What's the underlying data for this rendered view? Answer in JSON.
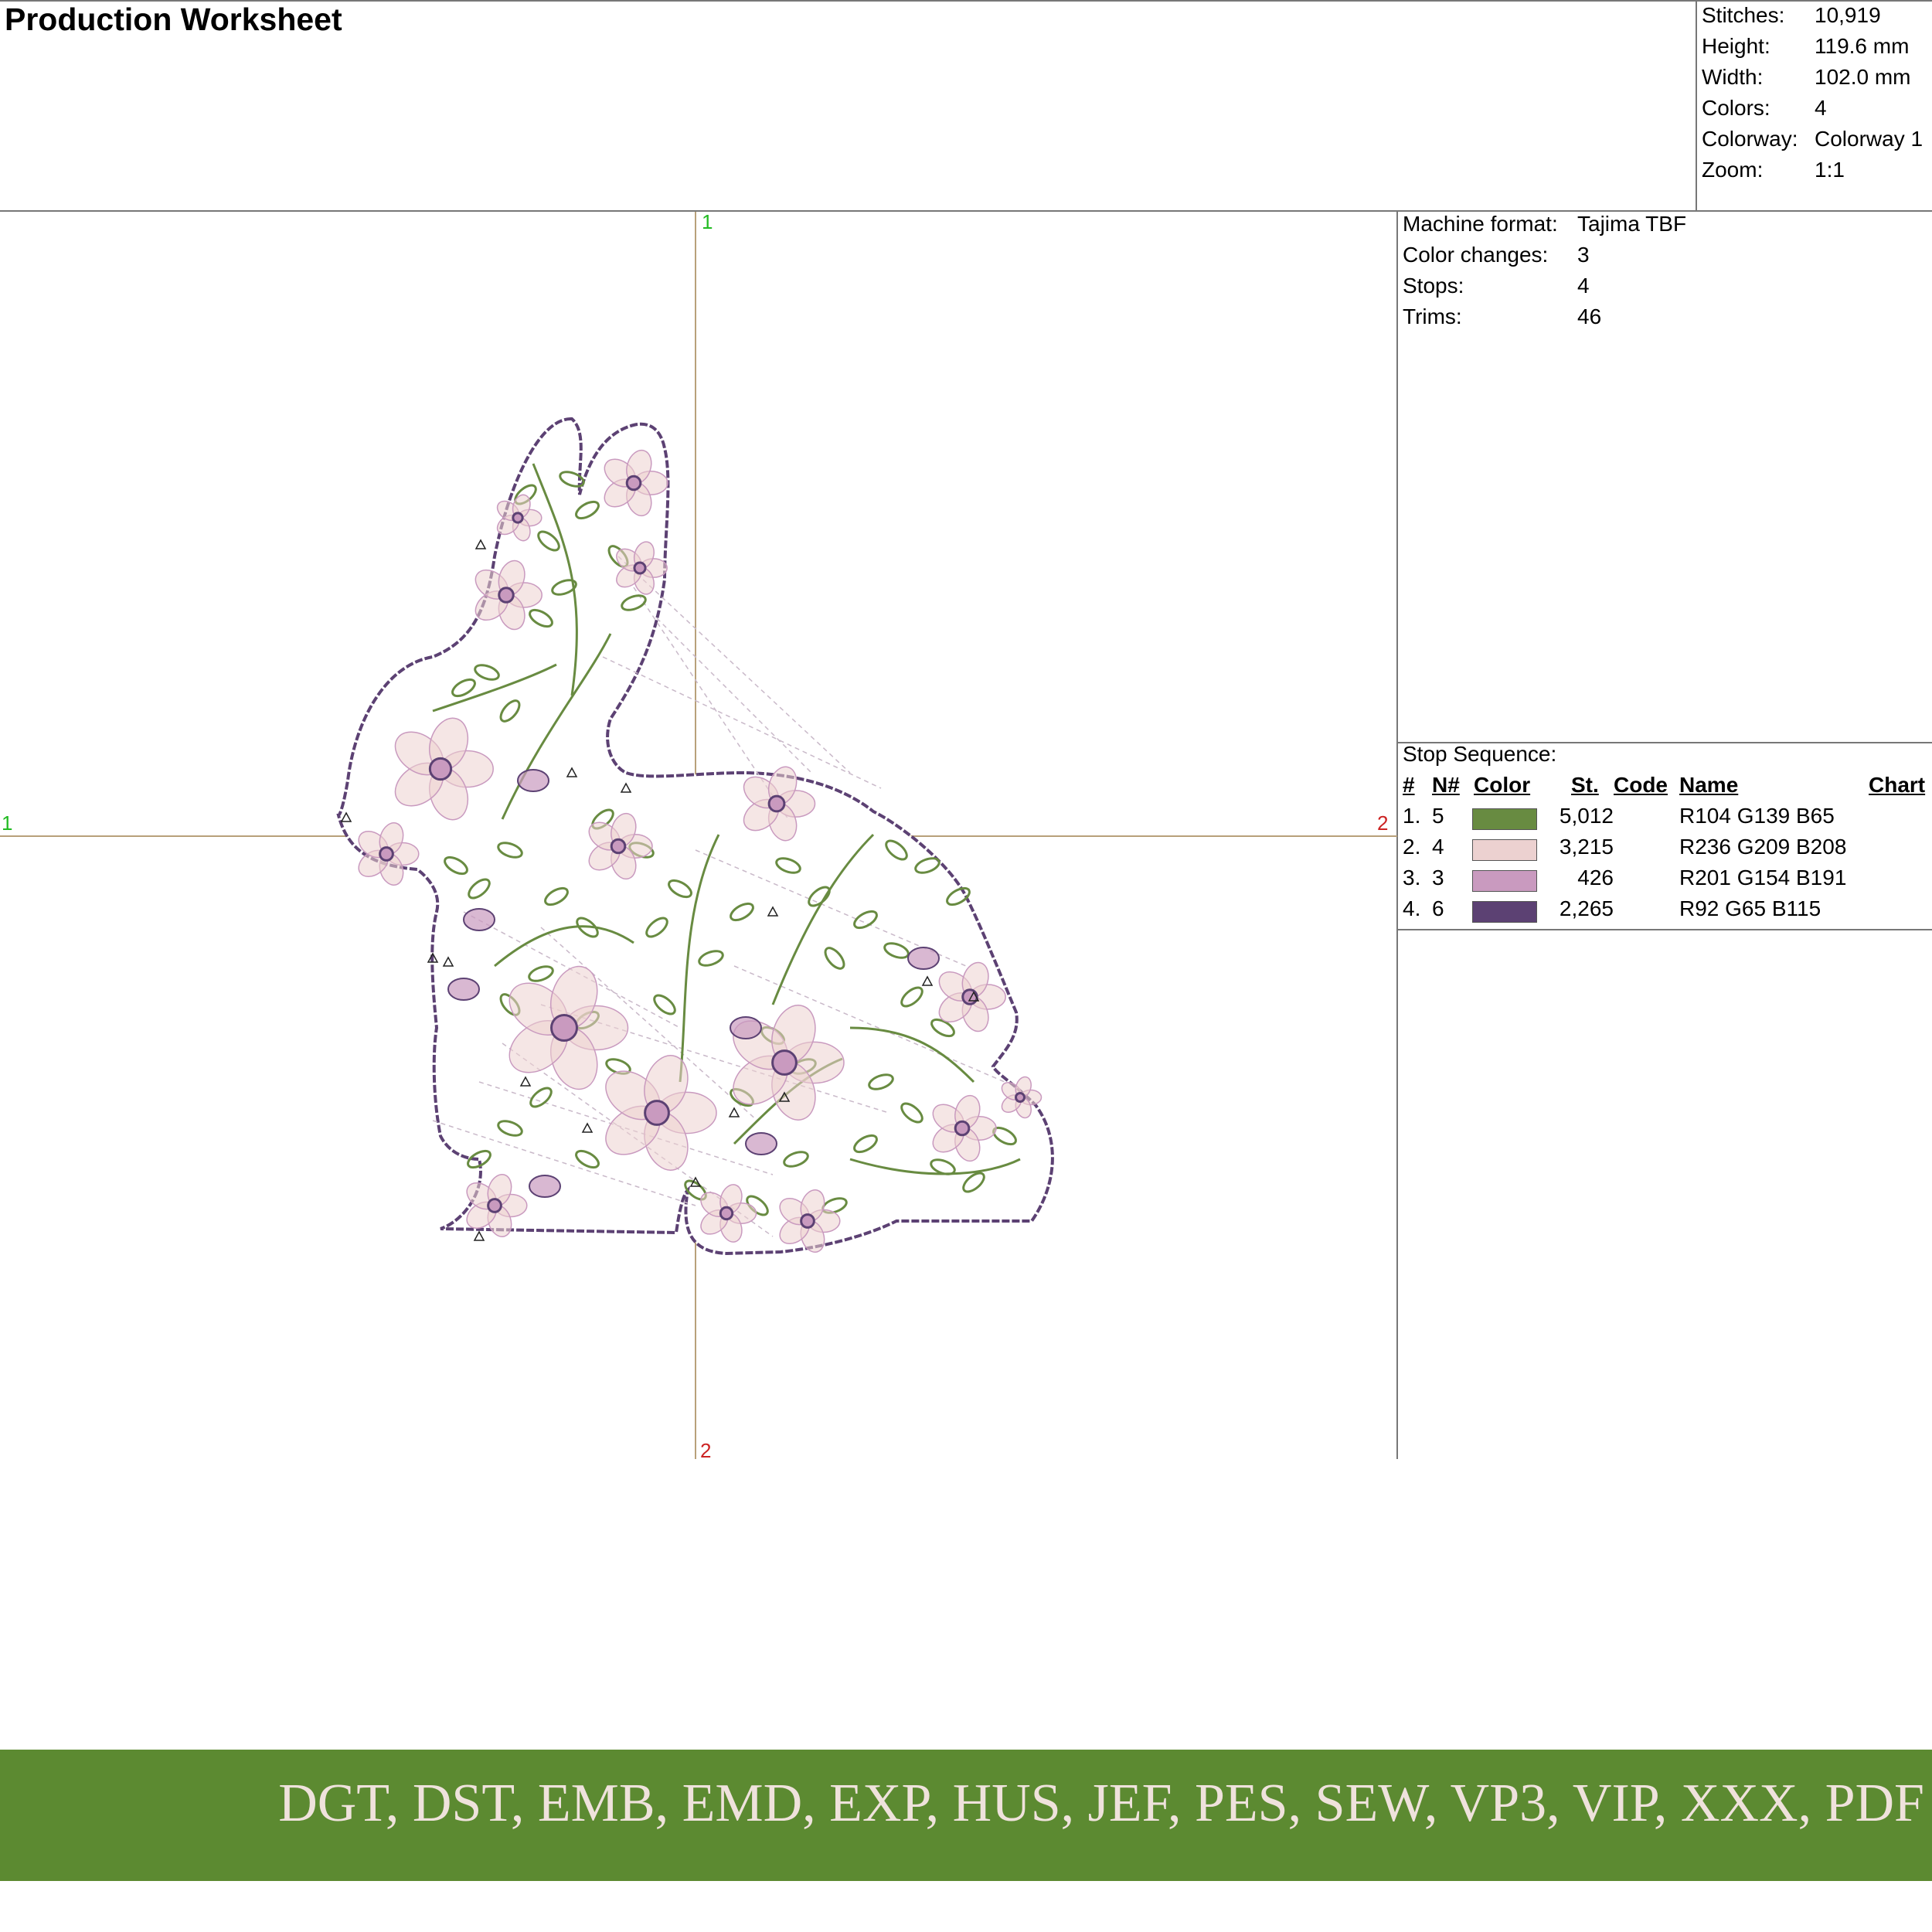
{
  "header": {
    "title": "Production Worksheet"
  },
  "summary": [
    {
      "label": "Stitches:",
      "value": "10,919"
    },
    {
      "label": "Height:",
      "value": "119.6 mm"
    },
    {
      "label": "Width:",
      "value": "102.0 mm"
    },
    {
      "label": "Colors:",
      "value": "4"
    },
    {
      "label": "Colorway:",
      "value": "Colorway 1"
    },
    {
      "label": "Zoom:",
      "value": "1:1"
    }
  ],
  "machine": [
    {
      "label": "Machine format:",
      "value": "Tajima TBF"
    },
    {
      "label": "Color changes:",
      "value": "3"
    },
    {
      "label": "Stops:",
      "value": "4"
    },
    {
      "label": "Trims:",
      "value": "46"
    }
  ],
  "stop_sequence": {
    "title": "Stop Sequence:",
    "headers": {
      "num": "#",
      "needle": "N#",
      "color": "Color",
      "stitches": "St.",
      "code": "Code",
      "name": "Name",
      "chart": "Chart"
    },
    "rows": [
      {
        "num": "1.",
        "needle": "5",
        "color": "#688b41",
        "stitches": "5,012",
        "code": "",
        "name": "R104 G139 B65"
      },
      {
        "num": "2.",
        "needle": "4",
        "color": "#ecd1d0",
        "stitches": "3,215",
        "code": "",
        "name": "R236 G209 B208"
      },
      {
        "num": "3.",
        "needle": "3",
        "color": "#c99abf",
        "stitches": "426",
        "code": "",
        "name": "R201 G154 B191"
      },
      {
        "num": "4.",
        "needle": "6",
        "color": "#5c4173",
        "stitches": "2,265",
        "code": "",
        "name": "R92 G65 B115"
      }
    ]
  },
  "axes": {
    "top": "1",
    "bottom": "2",
    "left": "1",
    "right": "2",
    "color_start": "#22bb22",
    "color_end": "#cc2222",
    "line_color": "#b8a07a"
  },
  "design": {
    "outline_color": "#5c4173",
    "leaf_color": "#688b41",
    "petal_color": "#ecd1d0",
    "bud_color": "#c99abf",
    "center_color": "#5c4173",
    "jump_color": "#c9b9c9"
  },
  "banner": {
    "background": "#5c8a31",
    "text": "DGT, DST, EMB, EMD, EXP, HUS, JEF, PES, SEW, VP3, VIP, XXX, PDF"
  }
}
